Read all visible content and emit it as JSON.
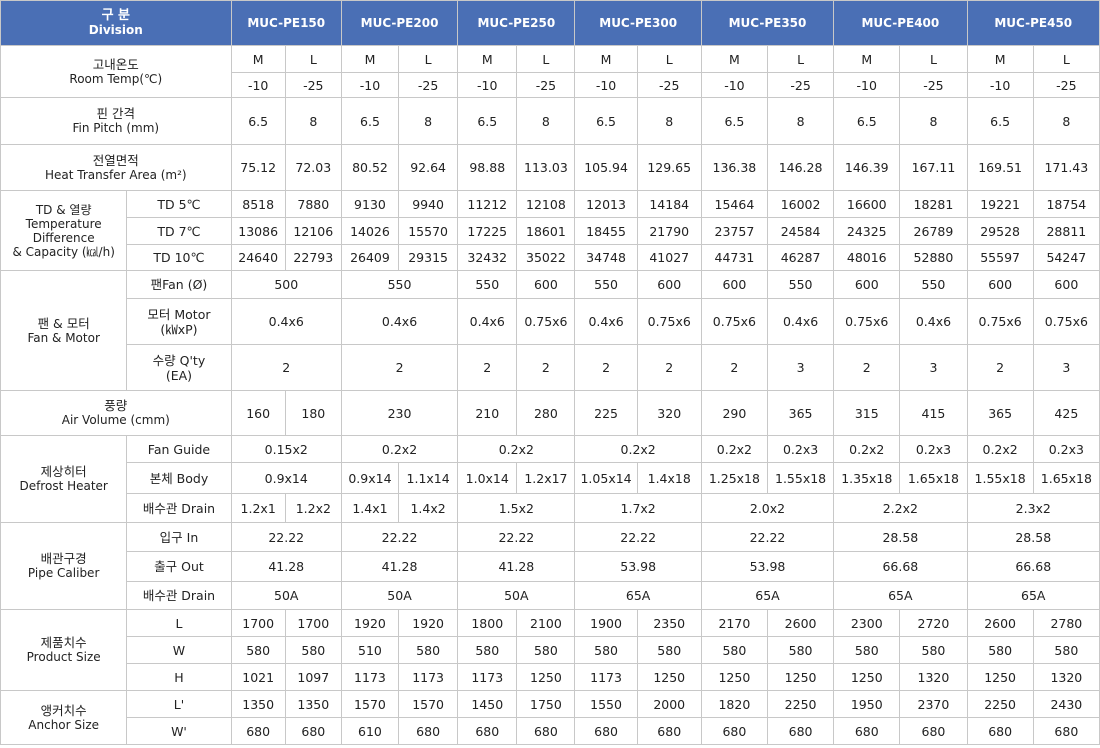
{
  "header": {
    "division_ko": "구 분",
    "division_en": "Division",
    "models": [
      "MUC-PE150",
      "MUC-PE200",
      "MUC-PE250",
      "MUC-PE300",
      "MUC-PE350",
      "MUC-PE400",
      "MUC-PE450"
    ]
  },
  "room_temp": {
    "label_ko": "고내온도",
    "label_en": "Room Temp(℃)",
    "types": [
      "M",
      "L",
      "M",
      "L",
      "M",
      "L",
      "M",
      "L",
      "M",
      "L",
      "M",
      "L",
      "M",
      "L"
    ],
    "temps": [
      "-10",
      "-25",
      "-10",
      "-25",
      "-10",
      "-25",
      "-10",
      "-25",
      "-10",
      "-25",
      "-10",
      "-25",
      "-10",
      "-25"
    ]
  },
  "fin_pitch": {
    "label_ko": "핀 간격",
    "label_en": "Fin Pitch (mm)",
    "values": [
      "6.5",
      "8",
      "6.5",
      "8",
      "6.5",
      "8",
      "6.5",
      "8",
      "6.5",
      "8",
      "6.5",
      "8",
      "6.5",
      "8"
    ]
  },
  "heat_area": {
    "label_ko": "전열면적",
    "label_en": "Heat Transfer Area (m²)",
    "values": [
      "75.12",
      "72.03",
      "80.52",
      "92.64",
      "98.88",
      "113.03",
      "105.94",
      "129.65",
      "136.38",
      "146.28",
      "146.39",
      "167.11",
      "169.51",
      "171.43"
    ]
  },
  "td": {
    "label_1": "TD & 열량",
    "label_2": "Temperature",
    "label_3": "Difference",
    "label_4": "& Capacity (㎉/h)",
    "rows": [
      {
        "label": "TD 5℃",
        "values": [
          "8518",
          "7880",
          "9130",
          "9940",
          "11212",
          "12108",
          "12013",
          "14184",
          "15464",
          "16002",
          "16600",
          "18281",
          "19221",
          "18754"
        ]
      },
      {
        "label": "TD 7℃",
        "values": [
          "13086",
          "12106",
          "14026",
          "15570",
          "17225",
          "18601",
          "18455",
          "21790",
          "23757",
          "24584",
          "24325",
          "26789",
          "29528",
          "28811"
        ]
      },
      {
        "label": "TD 10℃",
        "values": [
          "24640",
          "22793",
          "26409",
          "29315",
          "32432",
          "35022",
          "34748",
          "41027",
          "44731",
          "46287",
          "48016",
          "52880",
          "55597",
          "54247"
        ]
      }
    ]
  },
  "fan": {
    "label_ko": "팬 & 모터",
    "label_en": "Fan & Motor",
    "fan_label": "팬Fan (Ø)",
    "fan_values": [
      "500",
      "550",
      "550",
      "600",
      "550",
      "600",
      "600",
      "550",
      "600",
      "550",
      "600",
      "600"
    ],
    "motor_label_1": "모터 Motor",
    "motor_label_2": "(㎾xP)",
    "motor_values": [
      "0.4x6",
      "0.4x6",
      "0.4x6",
      "0.75x6",
      "0.4x6",
      "0.75x6",
      "0.75x6",
      "0.4x6",
      "0.75x6",
      "0.4x6",
      "0.75x6",
      "0.75x6"
    ],
    "qty_label_1": "수량 Q'ty",
    "qty_label_2": "(EA)",
    "qty_values": [
      "2",
      "2",
      "2",
      "2",
      "2",
      "2",
      "2",
      "3",
      "2",
      "3",
      "2",
      "3"
    ]
  },
  "air": {
    "label_ko": "풍량",
    "label_en": "Air Volume (cmm)",
    "values": [
      "160",
      "180",
      "230",
      "210",
      "280",
      "225",
      "320",
      "290",
      "365",
      "315",
      "415",
      "365",
      "425"
    ]
  },
  "defrost": {
    "label_ko": "제상히터",
    "label_en": "Defrost Heater",
    "guide_label": "Fan Guide",
    "guide_values": [
      "0.15x2",
      "0.2x2",
      "0.2x2",
      "0.2x2",
      "0.2x2",
      "0.2x3",
      "0.2x2",
      "0.2x3",
      "0.2x2",
      "0.2x3"
    ],
    "body_label": "본체 Body",
    "body_values": [
      "0.9x14",
      "0.9x14",
      "1.1x14",
      "1.0x14",
      "1.2x17",
      "1.05x14",
      "1.4x18",
      "1.25x18",
      "1.55x18",
      "1.35x18",
      "1.65x18",
      "1.55x18",
      "1.65x18"
    ],
    "drain_label": "배수관 Drain",
    "drain_values": [
      "1.2x1",
      "1.2x2",
      "1.4x1",
      "1.4x2",
      "1.5x2",
      "1.7x2",
      "2.0x2",
      "2.2x2",
      "2.3x2"
    ]
  },
  "pipe": {
    "label_ko": "배관구경",
    "label_en": "Pipe Caliber",
    "in_label": "입구 In",
    "in_values": [
      "22.22",
      "22.22",
      "22.22",
      "22.22",
      "22.22",
      "28.58",
      "28.58"
    ],
    "out_label": "출구 Out",
    "out_values": [
      "41.28",
      "41.28",
      "41.28",
      "53.98",
      "53.98",
      "66.68",
      "66.68"
    ],
    "drain_label": "배수관 Drain",
    "drain_values": [
      "50A",
      "50A",
      "50A",
      "65A",
      "65A",
      "65A",
      "65A"
    ]
  },
  "product": {
    "label_ko": "제품치수",
    "label_en": "Product Size",
    "rows": [
      {
        "label": "L",
        "values": [
          "1700",
          "1700",
          "1920",
          "1920",
          "1800",
          "2100",
          "1900",
          "2350",
          "2170",
          "2600",
          "2300",
          "2720",
          "2600",
          "2780"
        ]
      },
      {
        "label": "W",
        "values": [
          "580",
          "580",
          "510",
          "580",
          "580",
          "580",
          "580",
          "580",
          "580",
          "580",
          "580",
          "580",
          "580",
          "580"
        ]
      },
      {
        "label": "H",
        "values": [
          "1021",
          "1097",
          "1173",
          "1173",
          "1173",
          "1250",
          "1173",
          "1250",
          "1250",
          "1250",
          "1250",
          "1320",
          "1250",
          "1320"
        ]
      }
    ]
  },
  "anchor": {
    "label_ko": "앵커치수",
    "label_en": "Anchor Size",
    "rows": [
      {
        "label": "L'",
        "values": [
          "1350",
          "1350",
          "1570",
          "1570",
          "1450",
          "1750",
          "1550",
          "2000",
          "1820",
          "2250",
          "1950",
          "2370",
          "2250",
          "2430"
        ]
      },
      {
        "label": "W'",
        "values": [
          "680",
          "680",
          "610",
          "680",
          "680",
          "680",
          "680",
          "680",
          "680",
          "680",
          "680",
          "680",
          "680",
          "680"
        ]
      }
    ]
  }
}
